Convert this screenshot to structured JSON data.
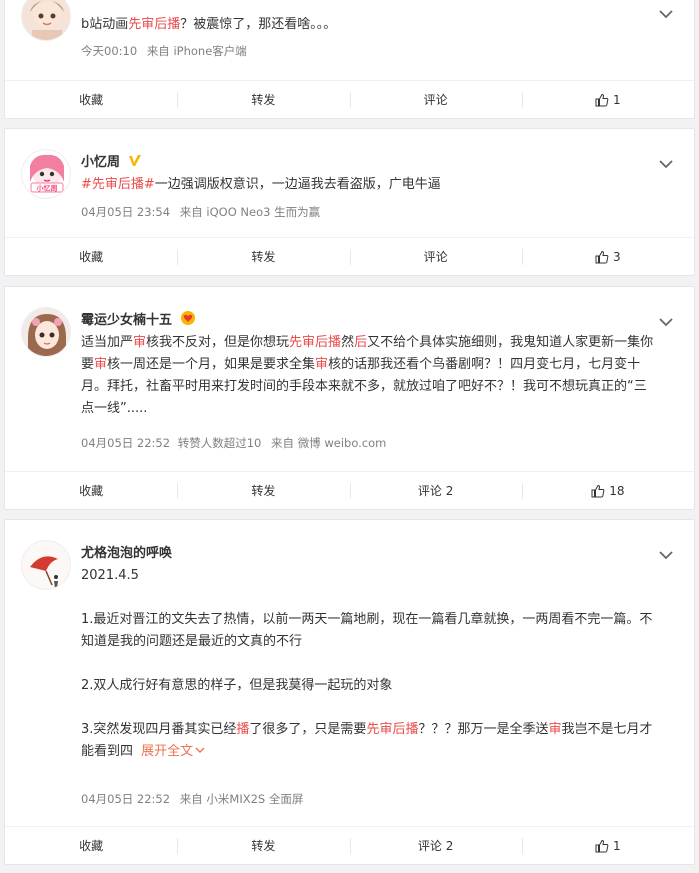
{
  "posts": [
    {
      "author": "",
      "text_parts": [
        "b站动画",
        "先审后播",
        "？被震惊了，那还看啥。。。"
      ],
      "time": "今天00:10",
      "source_prefix": "来自",
      "source": "iPhone客户端",
      "actions": {
        "collect": "收藏",
        "repost": "转发",
        "comment": "评论",
        "like_count": "1"
      }
    },
    {
      "author": "小忆周",
      "text_parts": [
        "#先审后播#",
        "一边强调版权意识，一边逼我去看盗版，广电牛逼"
      ],
      "time": "04月05日 23:54",
      "source_prefix": "来自",
      "source": "iQOO Neo3 生而为赢",
      "actions": {
        "collect": "收藏",
        "repost": "转发",
        "comment": "评论",
        "like_count": "3"
      }
    },
    {
      "author": "霉运少女楠十五",
      "text_parts": [
        "适当加严",
        "审",
        "核我不反对，但是你想玩",
        "先审后播",
        "然",
        "后",
        "又不给个具体实施细则，我鬼知道人家更新一集你要",
        "审",
        "核一周还是一个月，如果是要求全集",
        "审",
        "核的话那我还看个鸟番剧啊？！四月变七月，七月变十月。拜托，社畜平时用来打发时间的手段本来就不多，就放过咱了吧好不？！我可不想玩真正的“三点一线”....."
      ],
      "time": "04月05日 22:52",
      "repost_info": "转赞人数超过10",
      "source_prefix": "来自",
      "source": "微博 weibo.com",
      "actions": {
        "collect": "收藏",
        "repost": "转发",
        "comment": "评论 2",
        "like_count": "18"
      }
    },
    {
      "author": "尤格泡泡的呼唤",
      "date_line": "2021.4.5",
      "para1": "1.最近对晋江的文失去了热情，以前一两天一篇地刷，现在一篇看几章就换，一两周看不完一篇。不知道是我的问题还是最近的文真的不行",
      "para2": "2.双人成行好有意思的样子，但是我莫得一起玩的对象",
      "para3_parts": [
        "3.突然发现四月番其实已经",
        "播",
        "了很多了，只是需要",
        "先审后播",
        "？？？那万一是全季送",
        "审",
        "我岂不是七月才能看到四"
      ],
      "expand": "展开全文",
      "time": "04月05日 22:52",
      "source_prefix": "来自",
      "source": "小米MIX2S 全面屏",
      "actions": {
        "collect": "收藏",
        "repost": "转发",
        "comment": "评论 2",
        "like_count": "1"
      }
    }
  ],
  "colors": {
    "highlight": "#eb4b4b",
    "badge": "#f7b500",
    "meta": "#808080"
  },
  "icons": {
    "chevron": "chevron-down-icon",
    "like": "thumb-up-icon",
    "verified": "verified-badge-icon",
    "vip": "vip-heart-badge-icon"
  }
}
